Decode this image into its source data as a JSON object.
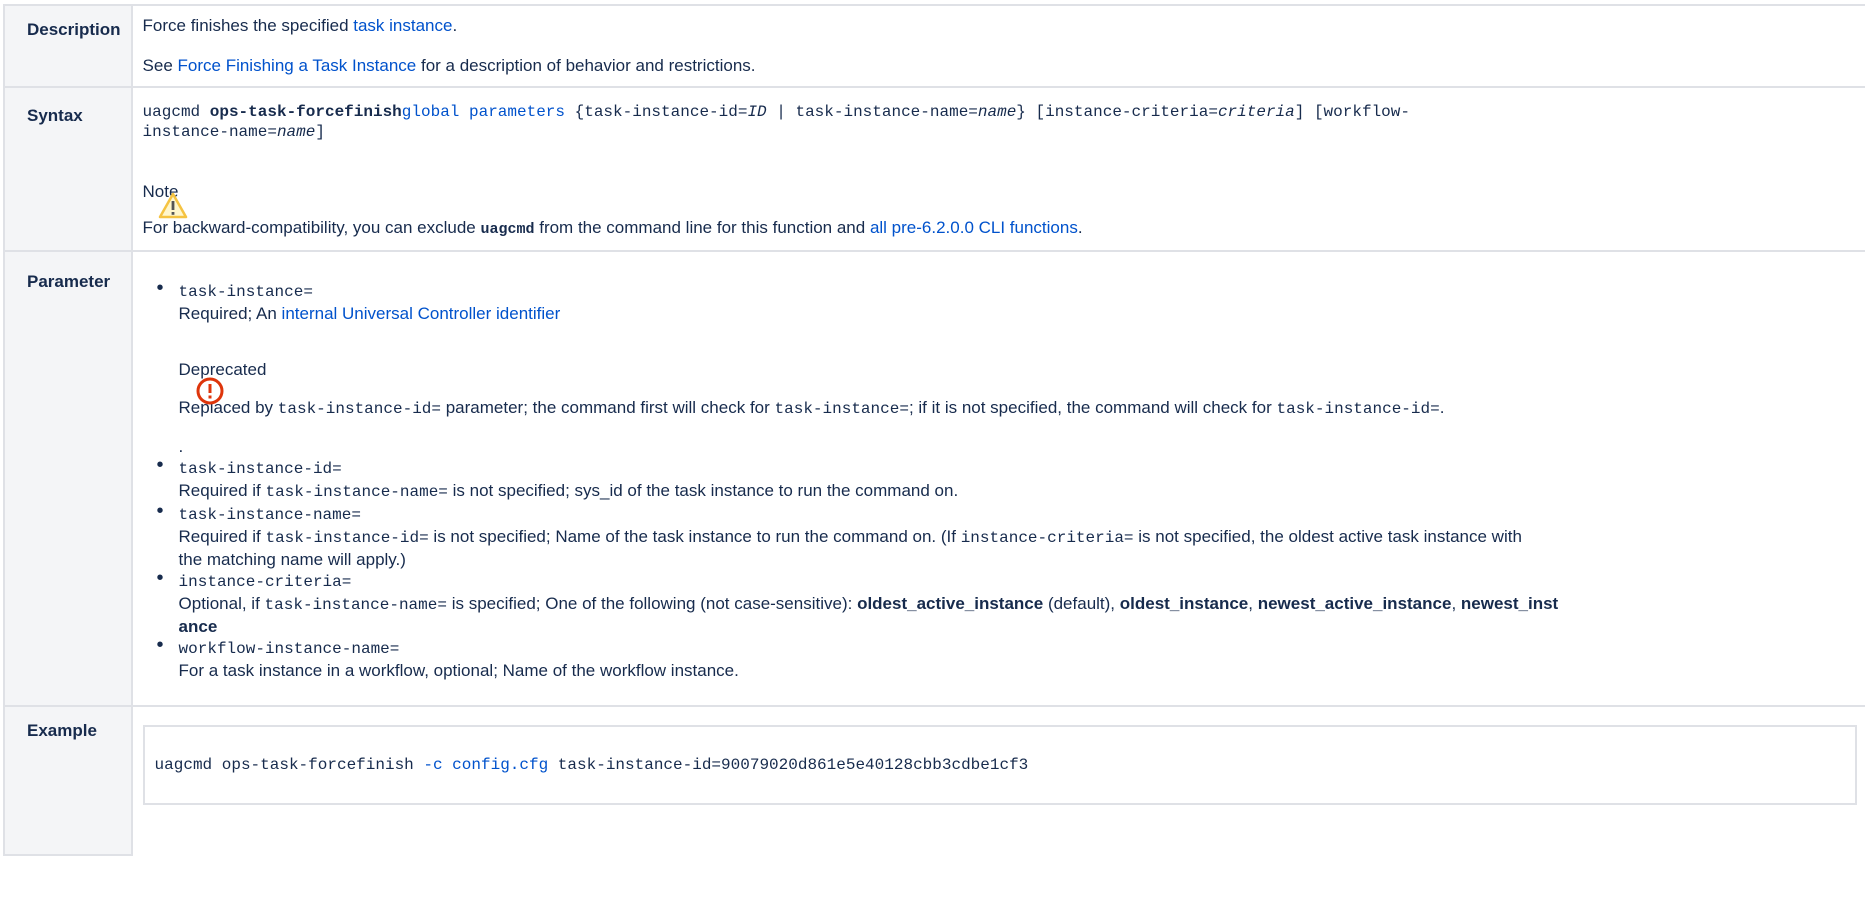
{
  "description": {
    "header": "Description",
    "line1_prefix": "Force finishes the specified ",
    "line1_link": "task instance",
    "line1_suffix": ".",
    "line2_prefix": "See ",
    "line2_link": "Force Finishing a Task Instance",
    "line2_suffix": " for a description of behavior and restrictions."
  },
  "syntax": {
    "header": "Syntax",
    "cmd": "uagcmd ",
    "cmd_bold": "ops-task-forcefinish",
    "global_link": "global parameters",
    "part1": " {task-instance-id=",
    "id_italic": "ID",
    "part2": " | task-instance-name=",
    "name_italic": "name",
    "part3": "} [instance-criteria=",
    "criteria_italic": "criteria",
    "part4": "] [workflow-",
    "part5": "instance-name=",
    "name2_italic": "name",
    "part6": "]",
    "note_title": "Note",
    "note_prefix": "For backward-compatibility, you can exclude ",
    "note_code": "uagcmd",
    "note_middle": " from the command line for this function and ",
    "note_link": "all pre-6.2.0.0 CLI functions",
    "note_suffix": "."
  },
  "parameter": {
    "header": "Parameter",
    "p1_name": "task-instance=",
    "p1_desc_prefix": "Required; An ",
    "p1_desc_link": "internal Universal Controller identifier",
    "deprecated_title": "Deprecated",
    "deprecated_prefix": "Replaced by ",
    "deprecated_code1": "task-instance-id=",
    "deprecated_middle1": " parameter; the command first will check for ",
    "deprecated_code2": "task-instance=",
    "deprecated_middle2": "; if it is not specified, the command will check for ",
    "deprecated_code3": "task-instance-id=",
    "deprecated_suffix": ".",
    "period": ".",
    "p2_name": "task-instance-id=",
    "p2_desc_prefix": "Required if ",
    "p2_desc_code": "task-instance-name=",
    "p2_desc_suffix": " is not specified; sys_id of the task instance to run the command on.",
    "p3_name": "task-instance-name=",
    "p3_desc_prefix": "Required if ",
    "p3_desc_code1": "task-instance-id=",
    "p3_desc_middle": " is not specified; Name of the task instance to run the command on. (If ",
    "p3_desc_code2": "instance-criteria=",
    "p3_desc_suffix1": " is not specified, the oldest active task instance with",
    "p3_desc_suffix2": "the matching name will apply.)",
    "p4_name": "instance-criteria=",
    "p4_desc_prefix": "Optional, if ",
    "p4_desc_code": "task-instance-name=",
    "p4_desc_middle": " is specified; One of the following (not case-sensitive): ",
    "p4_opt1": "oldest_active_instance",
    "p4_default": " (default), ",
    "p4_opt2": "oldest_instance",
    "p4_comma1": ", ",
    "p4_opt3": "newest_active_instance",
    "p4_comma2": ", ",
    "p4_opt4a": "newest_inst",
    "p4_opt4b": "ance",
    "p5_name": "workflow-instance-name=",
    "p5_desc": "For a task instance in a workflow, optional; Name of the workflow instance."
  },
  "example": {
    "header": "Example",
    "cmd": "uagcmd ops-task-forcefinish ",
    "flag": "-c config.cfg",
    "rest": " task-instance-id=90079020d861e5e40128cbb3cdbe1cf3"
  }
}
